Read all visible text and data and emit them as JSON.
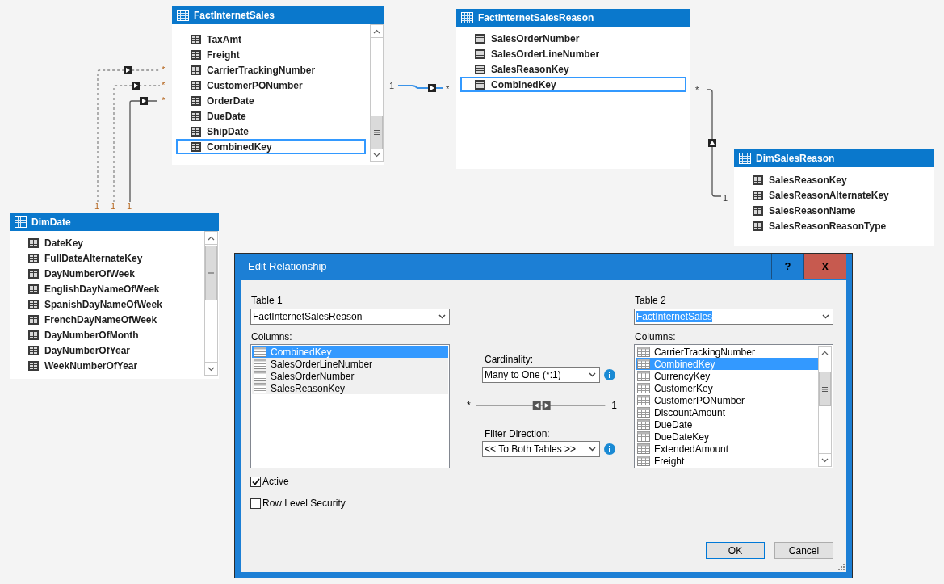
{
  "diagram": {
    "tables": [
      {
        "name": "FactInternetSales",
        "columns": [
          {
            "name": "TaxAmt",
            "selected": false
          },
          {
            "name": "Freight",
            "selected": false
          },
          {
            "name": "CarrierTrackingNumber",
            "selected": false
          },
          {
            "name": "CustomerPONumber",
            "selected": false
          },
          {
            "name": "OrderDate",
            "selected": false
          },
          {
            "name": "DueDate",
            "selected": false
          },
          {
            "name": "ShipDate",
            "selected": false
          },
          {
            "name": "CombinedKey",
            "selected": true
          }
        ]
      },
      {
        "name": "FactInternetSalesReason",
        "columns": [
          {
            "name": "SalesOrderNumber",
            "selected": false
          },
          {
            "name": "SalesOrderLineNumber",
            "selected": false
          },
          {
            "name": "SalesReasonKey",
            "selected": false
          },
          {
            "name": "CombinedKey",
            "selected": true
          }
        ]
      },
      {
        "name": "DimSalesReason",
        "columns": [
          {
            "name": "SalesReasonKey",
            "selected": false
          },
          {
            "name": "SalesReasonAlternateKey",
            "selected": false
          },
          {
            "name": "SalesReasonName",
            "selected": false
          },
          {
            "name": "SalesReasonReasonType",
            "selected": false
          }
        ]
      },
      {
        "name": "DimDate",
        "columns": [
          {
            "name": "DateKey",
            "selected": false
          },
          {
            "name": "FullDateAlternateKey",
            "selected": false
          },
          {
            "name": "DayNumberOfWeek",
            "selected": false
          },
          {
            "name": "EnglishDayNameOfWeek",
            "selected": false
          },
          {
            "name": "SpanishDayNameOfWeek",
            "selected": false
          },
          {
            "name": "FrenchDayNameOfWeek",
            "selected": false
          },
          {
            "name": "DayNumberOfMonth",
            "selected": false
          },
          {
            "name": "DayNumberOfYear",
            "selected": false
          },
          {
            "name": "WeekNumberOfYear",
            "selected": false
          }
        ]
      }
    ],
    "relationships": [
      {
        "from_end": "1",
        "to_end": "*",
        "active": false,
        "selected": false
      },
      {
        "from_end": "1",
        "to_end": "*",
        "active": false,
        "selected": false
      },
      {
        "from_end": "1",
        "to_end": "*",
        "active": true,
        "selected": false
      },
      {
        "from_end": "1",
        "to_end": "*",
        "active": true,
        "selected": true
      },
      {
        "from_end": "*",
        "to_end": "1",
        "active": true,
        "selected": false
      }
    ]
  },
  "dialog": {
    "title": "Edit Relationship",
    "help_button": "?",
    "close_button": "x",
    "tables": [
      {
        "label": "Table 1",
        "value": "FactInternetSalesReason",
        "value_highlighted": false,
        "columns_label": "Columns:",
        "columns": [
          {
            "name": "CombinedKey",
            "selected": true
          },
          {
            "name": "SalesOrderLineNumber",
            "selected": false
          },
          {
            "name": "SalesOrderNumber",
            "selected": false
          },
          {
            "name": "SalesReasonKey",
            "selected": false
          }
        ]
      },
      {
        "label": "Table 2",
        "value": "FactInternetSales",
        "value_highlighted": true,
        "columns_label": "Columns:",
        "columns": [
          {
            "name": "CarrierTrackingNumber",
            "selected": false
          },
          {
            "name": "CombinedKey",
            "selected": true
          },
          {
            "name": "CurrencyKey",
            "selected": false
          },
          {
            "name": "CustomerKey",
            "selected": false
          },
          {
            "name": "CustomerPONumber",
            "selected": false
          },
          {
            "name": "DiscountAmount",
            "selected": false
          },
          {
            "name": "DueDate",
            "selected": false
          },
          {
            "name": "DueDateKey",
            "selected": false
          },
          {
            "name": "ExtendedAmount",
            "selected": false
          },
          {
            "name": "Freight",
            "selected": false
          }
        ]
      }
    ],
    "cardinality": {
      "label": "Cardinality:",
      "value": "Many to One (*:1)",
      "from_end": "*",
      "to_end": "1"
    },
    "filter_direction": {
      "label": "Filter Direction:",
      "value": "<< To Both Tables >>"
    },
    "checkboxes": [
      {
        "label": "Active",
        "checked": true
      },
      {
        "label": "Row Level Security",
        "checked": false
      }
    ],
    "buttons": [
      {
        "label": "OK",
        "default": true
      },
      {
        "label": "Cancel",
        "default": false
      }
    ]
  }
}
